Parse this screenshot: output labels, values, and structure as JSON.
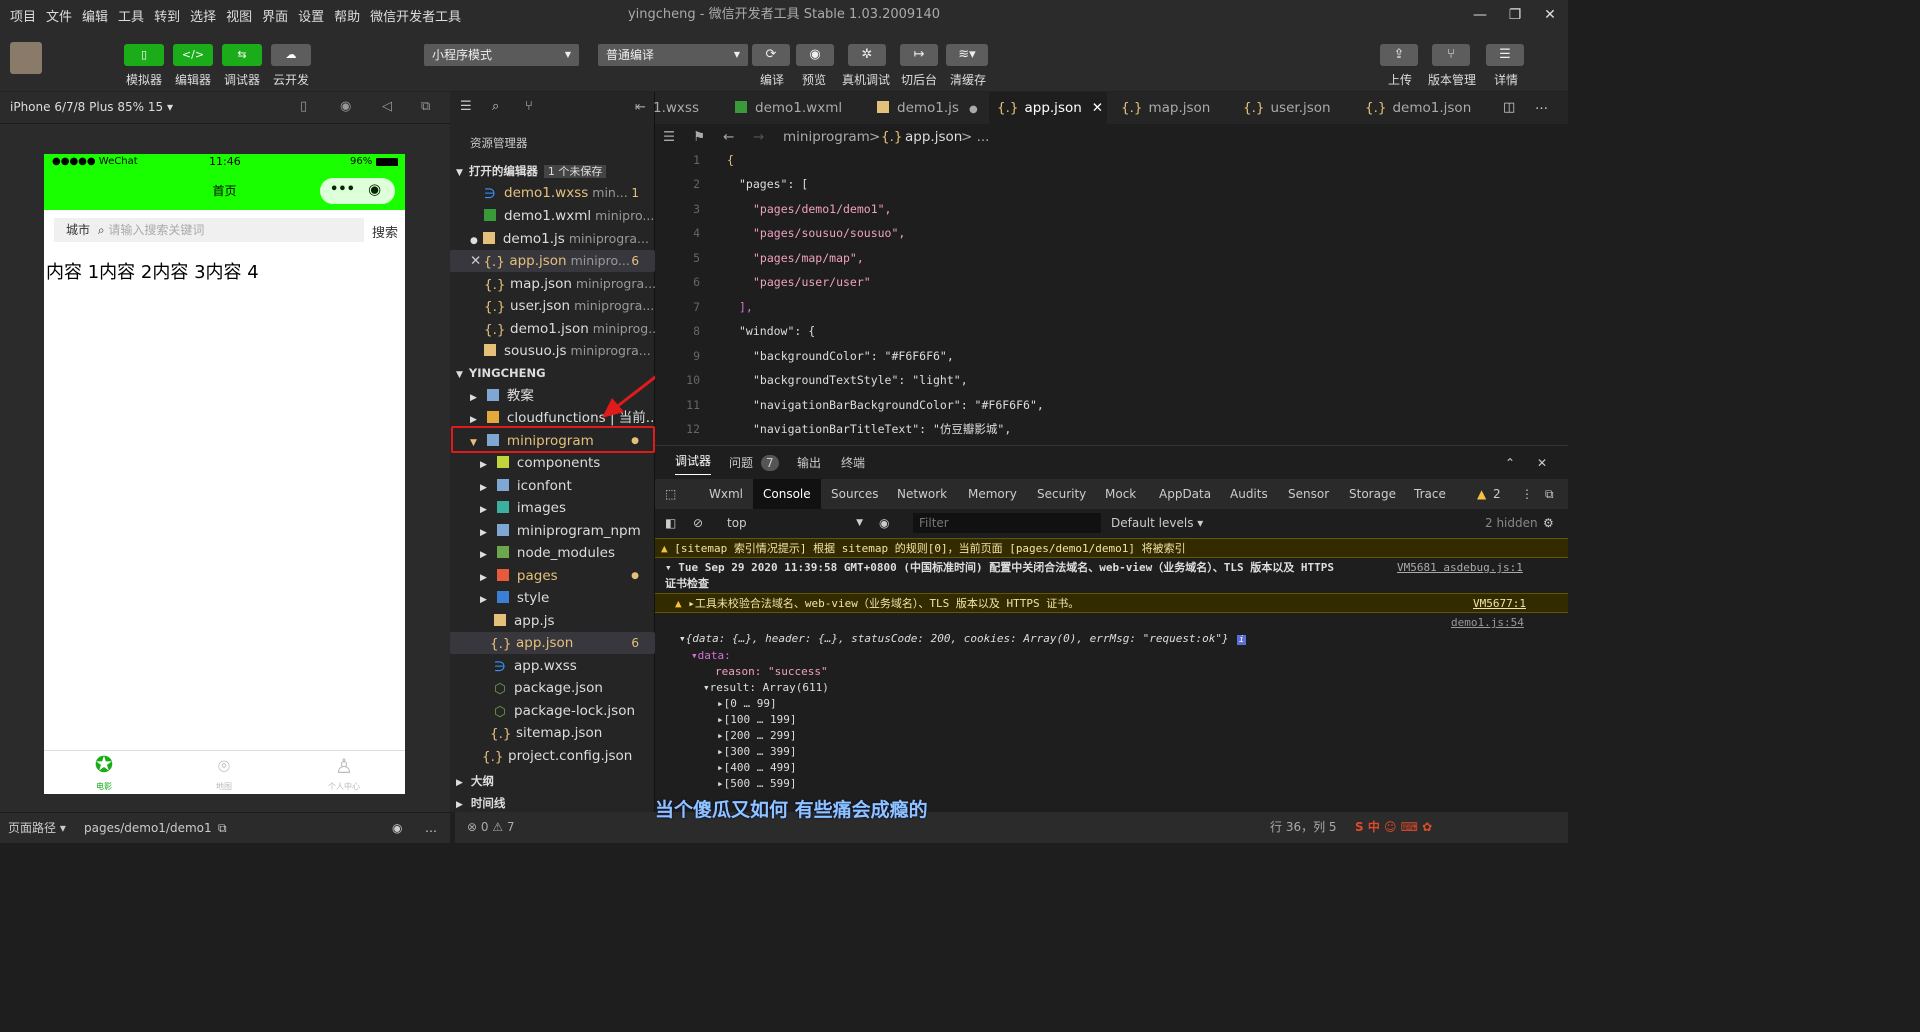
{
  "menu": [
    "项目",
    "文件",
    "编辑",
    "工具",
    "转到",
    "选择",
    "视图",
    "界面",
    "设置",
    "帮助",
    "微信开发者工具"
  ],
  "window_title": "yingcheng - 微信开发者工具 Stable 1.03.2009140",
  "toolbar": {
    "simulator": "模拟器",
    "editor": "编辑器",
    "debugger": "调试器",
    "cloud": "云开发",
    "mode": "小程序模式",
    "compile_mode": "普通编译",
    "compile": "编译",
    "preview": "预览",
    "real_debug": "真机调试",
    "background": "切后台",
    "clear_cache": "清缓存",
    "upload": "上传",
    "version": "版本管理",
    "details": "详情"
  },
  "sim": {
    "device": "iPhone 6/7/8 Plus 85% 15 ▾",
    "carrier": "●●●●● WeChat",
    "time": "11:46",
    "battery": "96%",
    "nav_title": "首页",
    "city": "城市",
    "search_placeholder": "请输入搜索关键词",
    "search_btn": "搜索",
    "content": "内容 1内容 2内容 3内容 4",
    "tab_movie": "电影",
    "tab_map": "地图",
    "tab_user": "个人中心",
    "footer_path_label": "页面路径 ▾",
    "footer_path": "pages/demo1/demo1"
  },
  "explorer": {
    "title": "资源管理器",
    "open_editors": "打开的编辑器",
    "unsaved": "1 个未保存",
    "project": "YINGCHENG",
    "outline": "大纲",
    "timeline": "时间线",
    "open_files": [
      {
        "name": "demo1.wxss",
        "desc": "min...",
        "badge": "1"
      },
      {
        "name": "demo1.wxml",
        "desc": "minipro...",
        "badge": ""
      },
      {
        "name": "demo1.js",
        "desc": "miniprogra...",
        "badge": ""
      },
      {
        "name": "app.json",
        "desc": "minipro...",
        "badge": "6"
      },
      {
        "name": "map.json",
        "desc": "miniprogra...",
        "badge": ""
      },
      {
        "name": "user.json",
        "desc": "miniprogra...",
        "badge": ""
      },
      {
        "name": "demo1.json",
        "desc": "miniprog...",
        "badge": ""
      },
      {
        "name": "sousuo.js",
        "desc": "miniprogra...",
        "badge": ""
      }
    ],
    "tree": [
      {
        "name": "教案"
      },
      {
        "name": "cloudfunctions | 当前..."
      },
      {
        "name": "miniprogram"
      },
      {
        "name": "components"
      },
      {
        "name": "iconfont"
      },
      {
        "name": "images"
      },
      {
        "name": "miniprogram_npm"
      },
      {
        "name": "node_modules"
      },
      {
        "name": "pages"
      },
      {
        "name": "style"
      },
      {
        "name": "app.js"
      },
      {
        "name": "app.json",
        "badge": "6"
      },
      {
        "name": "app.wxss"
      },
      {
        "name": "package.json"
      },
      {
        "name": "package-lock.json"
      },
      {
        "name": "sitemap.json"
      },
      {
        "name": "project.config.json"
      }
    ]
  },
  "tabs": [
    "1.wxss",
    "demo1.wxml",
    "demo1.js",
    "app.json",
    "map.json",
    "user.json",
    "demo1.json"
  ],
  "breadcrumb": {
    "folder": "miniprogram",
    "sep": ">",
    "file": "app.json",
    "more": "> ..."
  },
  "code": [
    {
      "n": "1",
      "t": "{"
    },
    {
      "n": "2",
      "t": "\"pages\": ["
    },
    {
      "n": "3",
      "t": "\"pages/demo1/demo1\","
    },
    {
      "n": "4",
      "t": "\"pages/sousuo/sousuo\","
    },
    {
      "n": "5",
      "t": "\"pages/map/map\","
    },
    {
      "n": "6",
      "t": "\"pages/user/user\""
    },
    {
      "n": "7",
      "t": "],"
    },
    {
      "n": "8",
      "t": "\"window\": {"
    },
    {
      "n": "9",
      "t": "\"backgroundColor\": \"#F6F6F6\","
    },
    {
      "n": "10",
      "t": "\"backgroundTextStyle\": \"light\","
    },
    {
      "n": "11",
      "t": "\"navigationBarBackgroundColor\": \"#F6F6F6\","
    },
    {
      "n": "12",
      "t": "\"navigationBarTitleText\": \"仿豆瓣影城\","
    }
  ],
  "devtools": {
    "panels": [
      "调试器",
      "问题",
      "输出",
      "终端"
    ],
    "problems_count": "7",
    "tabs": [
      "Wxml",
      "Console",
      "Sources",
      "Network",
      "Memory",
      "Security",
      "Mock",
      "AppData",
      "Audits",
      "Sensor",
      "Storage",
      "Trace"
    ],
    "warn_count": "2",
    "context": "top",
    "filter": "Filter",
    "levels": "Default levels ▾",
    "hidden": "2 hidden",
    "lines": [
      "[sitemap 索引情况提示] 根据 sitemap 的规则[0]，当前页面 [pages/demo1/demo1] 将被索引",
      "Tue Sep 29 2020 11:39:58 GMT+0800 (中国标准时间) 配置中关闭合法域名、web-view（业务域名）、TLS 版本以及 HTTPS",
      "证书检查",
      "▸工具未校验合法域名、web-view（业务域名）、TLS 版本以及 HTTPS 证书。",
      "▾{data: {…}, header: {…}, statusCode: 200, cookies: Array(0), errMsg: \"request:ok\"}",
      "▾data:",
      "reason: \"success\"",
      "▾result: Array(611)",
      "▸[0 … 99]",
      "▸[100 … 199]",
      "▸[200 … 299]",
      "▸[300 … 399]",
      "▸[400 … 499]",
      "▸[500 … 599]"
    ],
    "src1": "VM5681 asdebug.js:1",
    "src2": "VM5677:1",
    "src3": "demo1.js:54"
  },
  "status": {
    "errors": "⊗ 0 ⚠ 7",
    "pos": "行 36，列 5"
  },
  "subtitle": "当个傻瓜又如何 有些痛会成瘾的",
  "colors": {
    "accent": "#1aad19",
    "wechat_green": "#1aff00",
    "warning": "#f2e3a6"
  }
}
